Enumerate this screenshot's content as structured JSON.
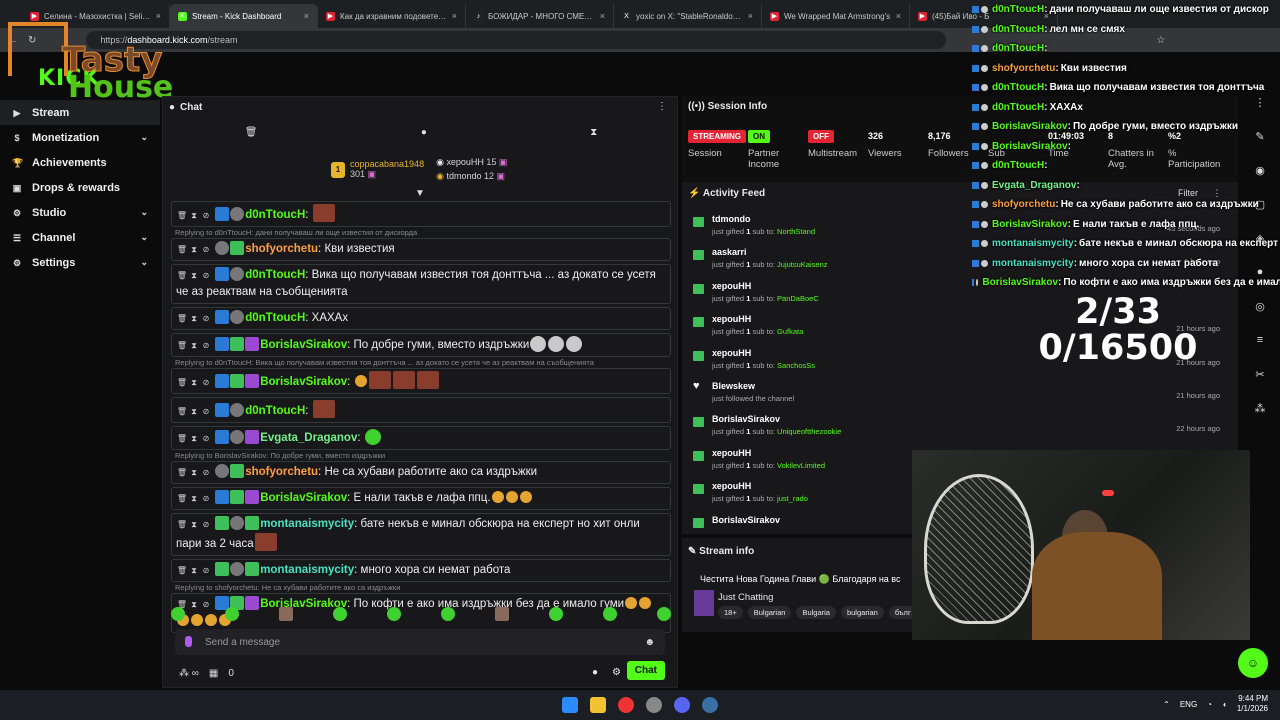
{
  "browser": {
    "tabs": [
      {
        "title": "Селина - Мазохистка | Selina",
        "fav_color": "#e22434",
        "fav": "▶",
        "active": false
      },
      {
        "title": "Stream - Kick Dashboard",
        "fav_color": "#53fc18",
        "fav": "K",
        "active": true
      },
      {
        "title": "Как да изравним подовете у д",
        "fav_color": "#e22434",
        "fav": "▶",
        "active": false
      },
      {
        "title": "БОЖИДАР - МНОГО СМЕШНИ",
        "fav_color": "#222",
        "fav": "♪",
        "active": false
      },
      {
        "title": "yoxic on X: \"StableRonaldo just",
        "fav_color": "#222",
        "fav": "X",
        "active": false
      },
      {
        "title": "We Wrapped Mat Armstrong's",
        "fav_color": "#e22434",
        "fav": "▶",
        "active": false
      },
      {
        "title": "(45)Бай Иво - Б",
        "fav_color": "#e22434",
        "fav": "▶",
        "active": false
      }
    ],
    "url_prefix": "https://",
    "url_host": "dashboard.kick.com",
    "url_path": "/stream"
  },
  "logo": {
    "overlay_line1": "Tasty",
    "overlay_line2": "House",
    "kick": "KICK"
  },
  "sidebar": {
    "items": [
      {
        "label": "Stream",
        "icon": "▶",
        "chev": ""
      },
      {
        "label": "Monetization",
        "icon": "$",
        "chev": "⌄"
      },
      {
        "label": "Achievements",
        "icon": "🏆",
        "chev": ""
      },
      {
        "label": "Drops & rewards",
        "icon": "▣",
        "chev": ""
      },
      {
        "label": "Studio",
        "icon": "⚙",
        "chev": "⌄"
      },
      {
        "label": "Channel",
        "icon": "☰",
        "chev": "⌄"
      },
      {
        "label": "Settings",
        "icon": "⚙",
        "chev": "⌄"
      }
    ]
  },
  "chat": {
    "title": "Chat",
    "gifters": [
      {
        "name": "coppacabana1948",
        "count": "301"
      },
      {
        "name": "хероuHH",
        "count": "15"
      },
      {
        "name": "tdmondo",
        "count": "12"
      }
    ],
    "input_placeholder": "Send a message",
    "footer_count": "0",
    "chat_button": "Chat",
    "messages": [
      {
        "reply": "",
        "badges": [
          "b-blue",
          "b-av"
        ],
        "user": "d0nTtoucH",
        "ucls": "u-green",
        "text": "",
        "emotes": [
          "emote"
        ]
      },
      {
        "reply": "Replying to d0nTtoucH: дани получаваш ли още известия от дискорда",
        "badges": [
          "b-av",
          "b-sub"
        ],
        "user": "shofyorchetu",
        "ucls": "u-orange",
        "text": "Кви известия",
        "emotes": []
      },
      {
        "reply": "",
        "badges": [
          "b-blue",
          "b-av"
        ],
        "user": "d0nTtoucH",
        "ucls": "u-green",
        "text": "Вика що получавам известия тоя донттъча ... аз докато се усетя че аз реактвам на съобщенията",
        "emotes": []
      },
      {
        "reply": "",
        "badges": [
          "b-blue",
          "b-av"
        ],
        "user": "d0nTtoucH",
        "ucls": "u-green",
        "text": "ХАХАх",
        "emotes": []
      },
      {
        "reply": "",
        "badges": [
          "b-blue",
          "b-sub",
          "b-gift"
        ],
        "user": "BorislavSirakov",
        "ucls": "u-green",
        "text": "По добре гуми, вместо издръжки",
        "emotes": [
          "emote face",
          "emote face",
          "emote face"
        ]
      },
      {
        "reply": "Replying to d0nTtoucH: Вика що получавам известия тоя донттъча ... аз докато се усетя че аз реактвам на съобщенията",
        "badges": [
          "b-blue",
          "b-sub",
          "b-gift"
        ],
        "user": "BorislavSirakov",
        "ucls": "u-green",
        "text": "",
        "emotes": [
          "emote smile",
          "emote",
          "emote",
          "emote"
        ]
      },
      {
        "reply": "",
        "badges": [
          "b-blue",
          "b-av"
        ],
        "user": "d0nTtoucH",
        "ucls": "u-green",
        "text": "",
        "emotes": [
          "emote"
        ]
      },
      {
        "reply": "",
        "badges": [
          "b-blue",
          "b-av",
          "b-gift"
        ],
        "user": "Evgata_Draganov",
        "ucls": "u-lime",
        "text": "",
        "emotes": [
          "emote grn"
        ]
      },
      {
        "reply": "Replying to BorislavSirakov: По добре гуми, вместо издръжки",
        "badges": [
          "b-av",
          "b-sub"
        ],
        "user": "shofyorchetu",
        "ucls": "u-orange",
        "text": "Не са хубави работите ако са издръжки",
        "emotes": []
      },
      {
        "reply": "",
        "badges": [
          "b-blue",
          "b-sub",
          "b-gift"
        ],
        "user": "BorislavSirakov",
        "ucls": "u-green",
        "text": "Е нали такъв е лафа ппц.",
        "emotes": [
          "emote smile",
          "emote smile",
          "emote smile"
        ]
      },
      {
        "reply": "",
        "badges": [
          "b-sub",
          "b-av",
          "b-sub"
        ],
        "user": "montanaismycity",
        "ucls": "u-teal",
        "text": "бате некъв е минал обскюра на експерт но хит онли пари за 2 часа",
        "emotes": [
          "emote"
        ]
      },
      {
        "reply": "",
        "badges": [
          "b-sub",
          "b-av",
          "b-sub"
        ],
        "user": "montanaismycity",
        "ucls": "u-teal",
        "text": "много хора си немат работа",
        "emotes": []
      },
      {
        "reply": "Replying to shofyorchetu: Не са хубави работите ако са издръжки",
        "badges": [
          "b-blue",
          "b-sub",
          "b-gift"
        ],
        "user": "BorislavSirakov",
        "ucls": "u-green",
        "text": "По кофти е ако има издръжки без да е имало гуми",
        "emotes": [
          "emote smile",
          "emote smile",
          "emote smile",
          "emote smile",
          "emote smile",
          "emote smile"
        ]
      }
    ]
  },
  "session": {
    "title": "Session Info",
    "cells": [
      {
        "value": "STREAMING",
        "style": "red",
        "label": "Session"
      },
      {
        "value": "ON",
        "style": "green",
        "label": "Partner Income"
      },
      {
        "value": "OFF",
        "style": "red",
        "label": "Multistream"
      },
      {
        "value": "326",
        "style": "",
        "label": "Viewers"
      },
      {
        "value": "8,176",
        "style": "",
        "label": "Followers"
      },
      {
        "value": "",
        "style": "",
        "label": "Sub"
      },
      {
        "value": "01:49:03",
        "style": "",
        "label": "Time"
      },
      {
        "value": "8",
        "style": "",
        "label": "Chatters in Avg."
      },
      {
        "value": "%2",
        "style": "",
        "label": "% Participation"
      }
    ]
  },
  "feed": {
    "title": "Activity Feed",
    "filter": "Filter",
    "items": [
      {
        "name": "tdmondo",
        "kind": "gift",
        "pre": "just gifted ",
        "n": "1",
        "mid": " sub to: ",
        "rc": "NorthStand",
        "time": "45 seconds ago"
      },
      {
        "name": "aaskarri",
        "kind": "gift",
        "pre": "just gifted ",
        "n": "1",
        "mid": " sub to: ",
        "rc": "JujutsuKaisenz",
        "time": "1 hour ago"
      },
      {
        "name": "хероuHH",
        "kind": "gift",
        "pre": "just gifted ",
        "n": "1",
        "mid": " sub to: ",
        "rc": "PanDaBoeC",
        "time": ""
      },
      {
        "name": "хероuHH",
        "kind": "gift",
        "pre": "just gifted ",
        "n": "1",
        "mid": " sub to: ",
        "rc": "Gufkata",
        "time": "21 hours ago"
      },
      {
        "name": "хероuHH",
        "kind": "gift",
        "pre": "just gifted ",
        "n": "1",
        "mid": " sub to: ",
        "rc": "SanchosSs",
        "time": "21 hours ago"
      },
      {
        "name": "Blewskew",
        "kind": "follow",
        "pre": "just followed the channel",
        "n": "",
        "mid": "",
        "rc": "",
        "time": "21 hours ago"
      },
      {
        "name": "BorislavSirakov",
        "kind": "gift",
        "pre": "just gifted ",
        "n": "1",
        "mid": " sub to: ",
        "rc": "Uniqueoftthezookie",
        "time": "22 hours ago"
      },
      {
        "name": "хероuHH",
        "kind": "gift",
        "pre": "just gifted ",
        "n": "1",
        "mid": " sub to: ",
        "rc": "VokilevLimited",
        "time": ""
      },
      {
        "name": "хероuHH",
        "kind": "gift",
        "pre": "just gifted ",
        "n": "1",
        "mid": " sub to: ",
        "rc": "just_rado",
        "time": ""
      },
      {
        "name": "BorislavSirakov",
        "kind": "gift",
        "pre": "",
        "n": "",
        "mid": "",
        "rc": "",
        "time": ""
      }
    ]
  },
  "stream_info": {
    "title": "Stream info",
    "stream_title": "Честита Нова Година Глави 🟢 Благодаря на вс",
    "category": "Just Chatting",
    "tags": [
      "18+",
      "Bulgarian",
      "Bulgaria",
      "bulgarian",
      "бълг"
    ]
  },
  "overlay": {
    "lines": [
      {
        "user": "d0nTtoucH",
        "color": "#53fc18",
        "text": "дани получаваш ли още известия от дискор"
      },
      {
        "user": "d0nTtoucH",
        "color": "#53fc18",
        "text": "лел мн се смях"
      },
      {
        "user": "d0nTtoucH",
        "color": "#53fc18",
        "text": ""
      },
      {
        "user": "shofyorchetu",
        "color": "#ff9f40",
        "text": "Кви известия"
      },
      {
        "user": "d0nTtoucH",
        "color": "#53fc18",
        "text": "Вика що получавам известия тоя донттъча"
      },
      {
        "user": "d0nTtoucH",
        "color": "#53fc18",
        "text": "ХАХАх"
      },
      {
        "user": "BorislavSirakov",
        "color": "#53fc18",
        "text": "По добре гуми, вместо издръжки"
      },
      {
        "user": "BorislavSirakov",
        "color": "#53fc18",
        "text": ""
      },
      {
        "user": "d0nTtoucH",
        "color": "#53fc18",
        "text": ""
      },
      {
        "user": "Evgata_Draganov",
        "color": "#72f08a",
        "text": ""
      },
      {
        "user": "shofyorchetu",
        "color": "#ff9f40",
        "text": "Не са хубави работите ако са издръжки"
      },
      {
        "user": "BorislavSirakov",
        "color": "#53fc18",
        "text": "Е нали такъв е лафа ппц."
      },
      {
        "user": "montanaismycity",
        "color": "#4ae0c0",
        "text": "бате некъв е минал обскюра на експерт"
      },
      {
        "user": "montanaismycity",
        "color": "#4ae0c0",
        "text": "много хора си немат работа"
      },
      {
        "user": "BorislavSirakov",
        "color": "#53fc18",
        "text": "По кофти е ако има издръжки без да е имал"
      }
    ],
    "counter_1": "2/33",
    "counter_2": "0/16500"
  },
  "taskbar": {
    "lang": "ENG",
    "time": "9:44 PM",
    "date": "1/1/2026"
  }
}
